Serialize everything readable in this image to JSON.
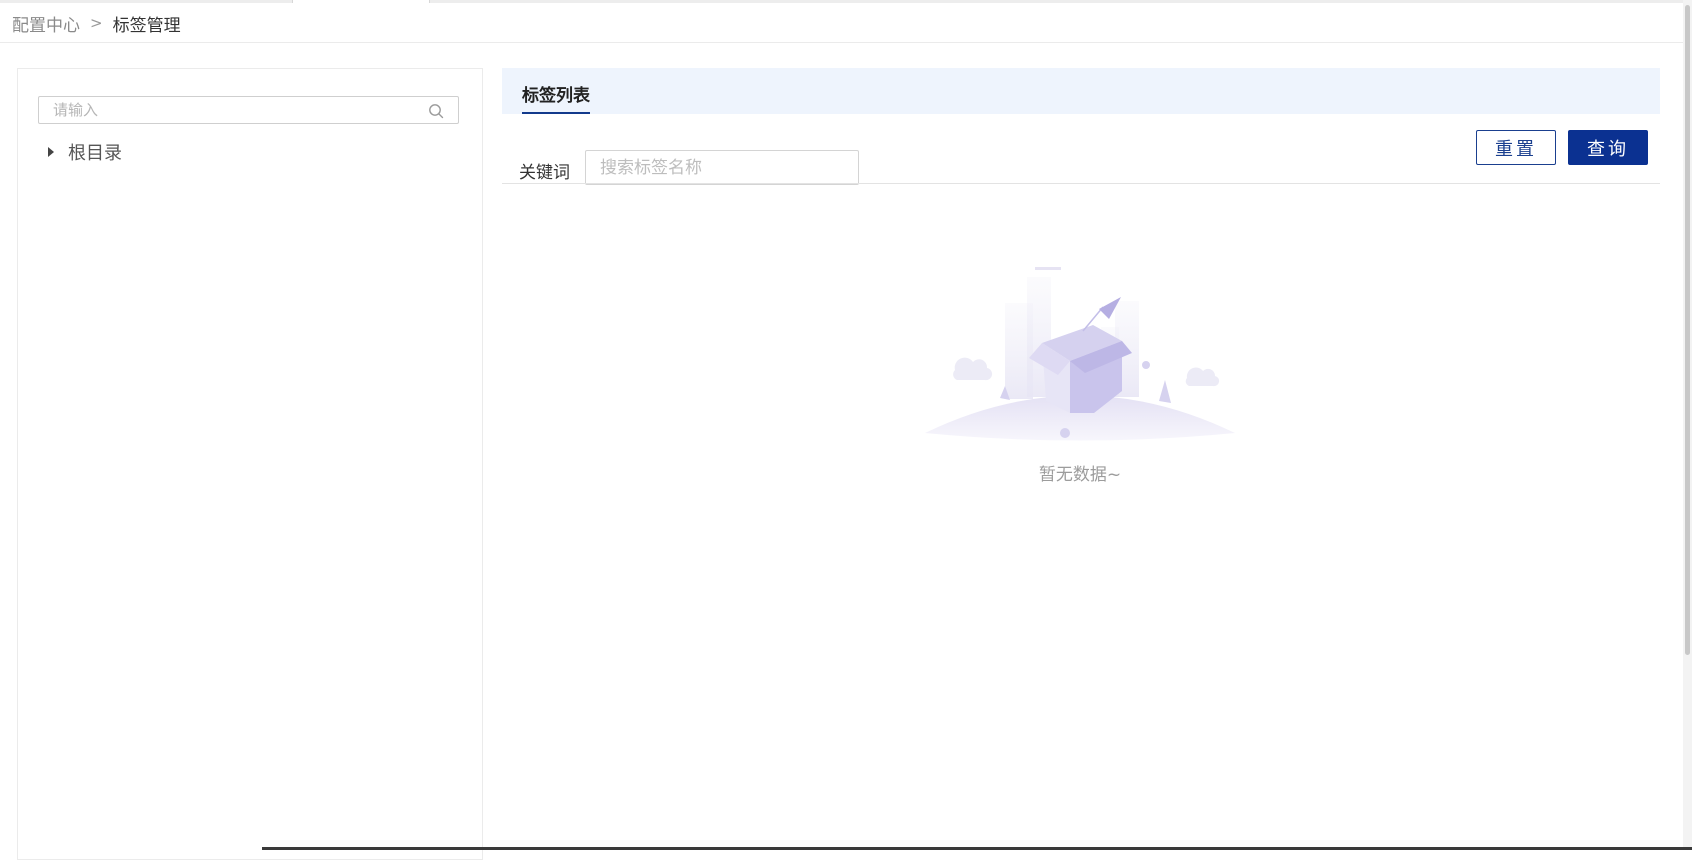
{
  "breadcrumb": {
    "parent": "配置中心",
    "separator": ">",
    "current": "标签管理"
  },
  "tree": {
    "search_placeholder": "请输入",
    "search_icon": "search-icon",
    "root_label": "根目录"
  },
  "list": {
    "tab_label": "标签列表",
    "keyword_label": "关键词",
    "keyword_placeholder": "搜索标签名称",
    "reset_label": "重置",
    "query_label": "查询",
    "empty_text": "暂无数据~"
  },
  "colors": {
    "primary": "#0b3191",
    "tab_bg": "#eef4fd",
    "empty_illustration": "#c9c4ec"
  }
}
